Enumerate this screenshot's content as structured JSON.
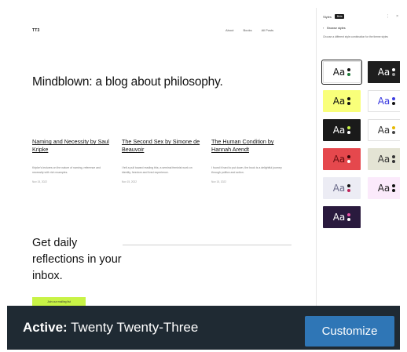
{
  "site": {
    "title": "TT3",
    "nav": [
      "About",
      "Books",
      "All Posts"
    ]
  },
  "hero": {
    "title": "Mindblown: a blog about philosophy."
  },
  "posts": [
    {
      "title": "Naming and Necessity by Saul Kripke",
      "excerpt": "Kripke's lectures on the nature of naming, reference and necessity with rich examples.",
      "date": "Nov 15, 2022"
    },
    {
      "title": "The Second Sex by Simone de Beauvoir",
      "excerpt": "I felt a pull toward reading this; a seminal feminist work on identity, freedom and lived experience.",
      "date": "Nov 15, 2022"
    },
    {
      "title": "The Human Condition by Hannah Arendt",
      "excerpt": "I found it hard to put down, the book is a delightful journey through politics and action.",
      "date": "Nov 15, 2022"
    }
  ],
  "cta": {
    "text": "Get daily reflections in your inbox.",
    "button": "Join our mailing list"
  },
  "panel": {
    "label": "Styles",
    "badge": "Beta",
    "sub": "Browse styles",
    "desc": "Choose a different style combination for the theme styles",
    "swatches": [
      {
        "label": "Aa",
        "bg": "#ffffff",
        "fg": "#111111",
        "dot1": "#111111",
        "dot2": "#1f7a3a",
        "selected": true
      },
      {
        "label": "Aa",
        "bg": "#1e1e1e",
        "fg": "#ffffff",
        "dot1": "#ffffff",
        "dot2": "#9a9a9a"
      },
      {
        "label": "Aa",
        "bg": "#f9ff7a",
        "fg": "#111111",
        "dot1": "#111111",
        "dot2": "#111111"
      },
      {
        "label": "Aa",
        "bg": "#ffffff",
        "fg": "#3a3ae0",
        "dot1": "#3a3ae0",
        "dot2": "#111111"
      },
      {
        "label": "Aa",
        "bg": "#1a1a1a",
        "fg": "#ffffff",
        "dot1": "#c8f346",
        "dot2": "#ffffff"
      },
      {
        "label": "Aa",
        "bg": "#ffffff",
        "fg": "#333333",
        "dot1": "#e6b800",
        "dot2": "#444444"
      },
      {
        "label": "Aa",
        "bg": "#e5484d",
        "fg": "#6b0f12",
        "dot1": "#3a0608",
        "dot2": "#ffffff"
      },
      {
        "label": "Aa",
        "bg": "#e4e4d4",
        "fg": "#333333",
        "dot1": "#333333",
        "dot2": "#333333"
      },
      {
        "label": "Aa",
        "bg": "#ececf4",
        "fg": "#6b6b8a",
        "dot1": "#111111",
        "dot2": "#c0245a"
      },
      {
        "label": "Aa",
        "bg": "#fbeafb",
        "fg": "#222222",
        "dot1": "#111111",
        "dot2": "#111111"
      },
      {
        "label": "Aa",
        "bg": "#2a1a3e",
        "fg": "#ffffff",
        "dot1": "#e84fa5",
        "dot2": "#ffffff"
      }
    ]
  },
  "footer": {
    "active_label": "Active:",
    "theme_name": "Twenty Twenty-Three",
    "customize": "Customize"
  }
}
